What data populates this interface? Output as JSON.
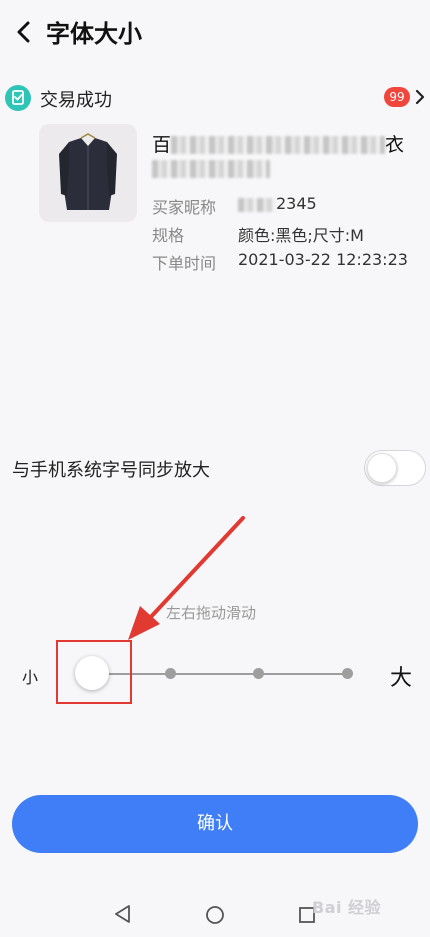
{
  "header": {
    "title": "字体大小"
  },
  "order": {
    "status": "交易成功",
    "badge_count": "99",
    "product_title_prefix": "百",
    "product_title_suffix": "衣",
    "buyer_label": "买家昵称",
    "buyer_value_suffix": "2345",
    "spec_label": "规格",
    "spec_value": "颜色:黑色;尺寸:M",
    "order_time_label": "下单时间",
    "order_time_value": "2021-03-22 12:23:23"
  },
  "settings": {
    "sync_label": "与手机系统字号同步放大",
    "sync_enabled": false
  },
  "slider": {
    "hint": "左右拖动滑动",
    "small_label": "小",
    "large_label": "大",
    "steps": 4,
    "current_step": 1
  },
  "actions": {
    "confirm_label": "确认"
  },
  "watermark": {
    "text": "Bai 经验"
  },
  "colors": {
    "primary": "#3f7ef7",
    "badge": "#f0463c",
    "annotation": "#e13a32",
    "success_icon": "#2ec4b6"
  }
}
